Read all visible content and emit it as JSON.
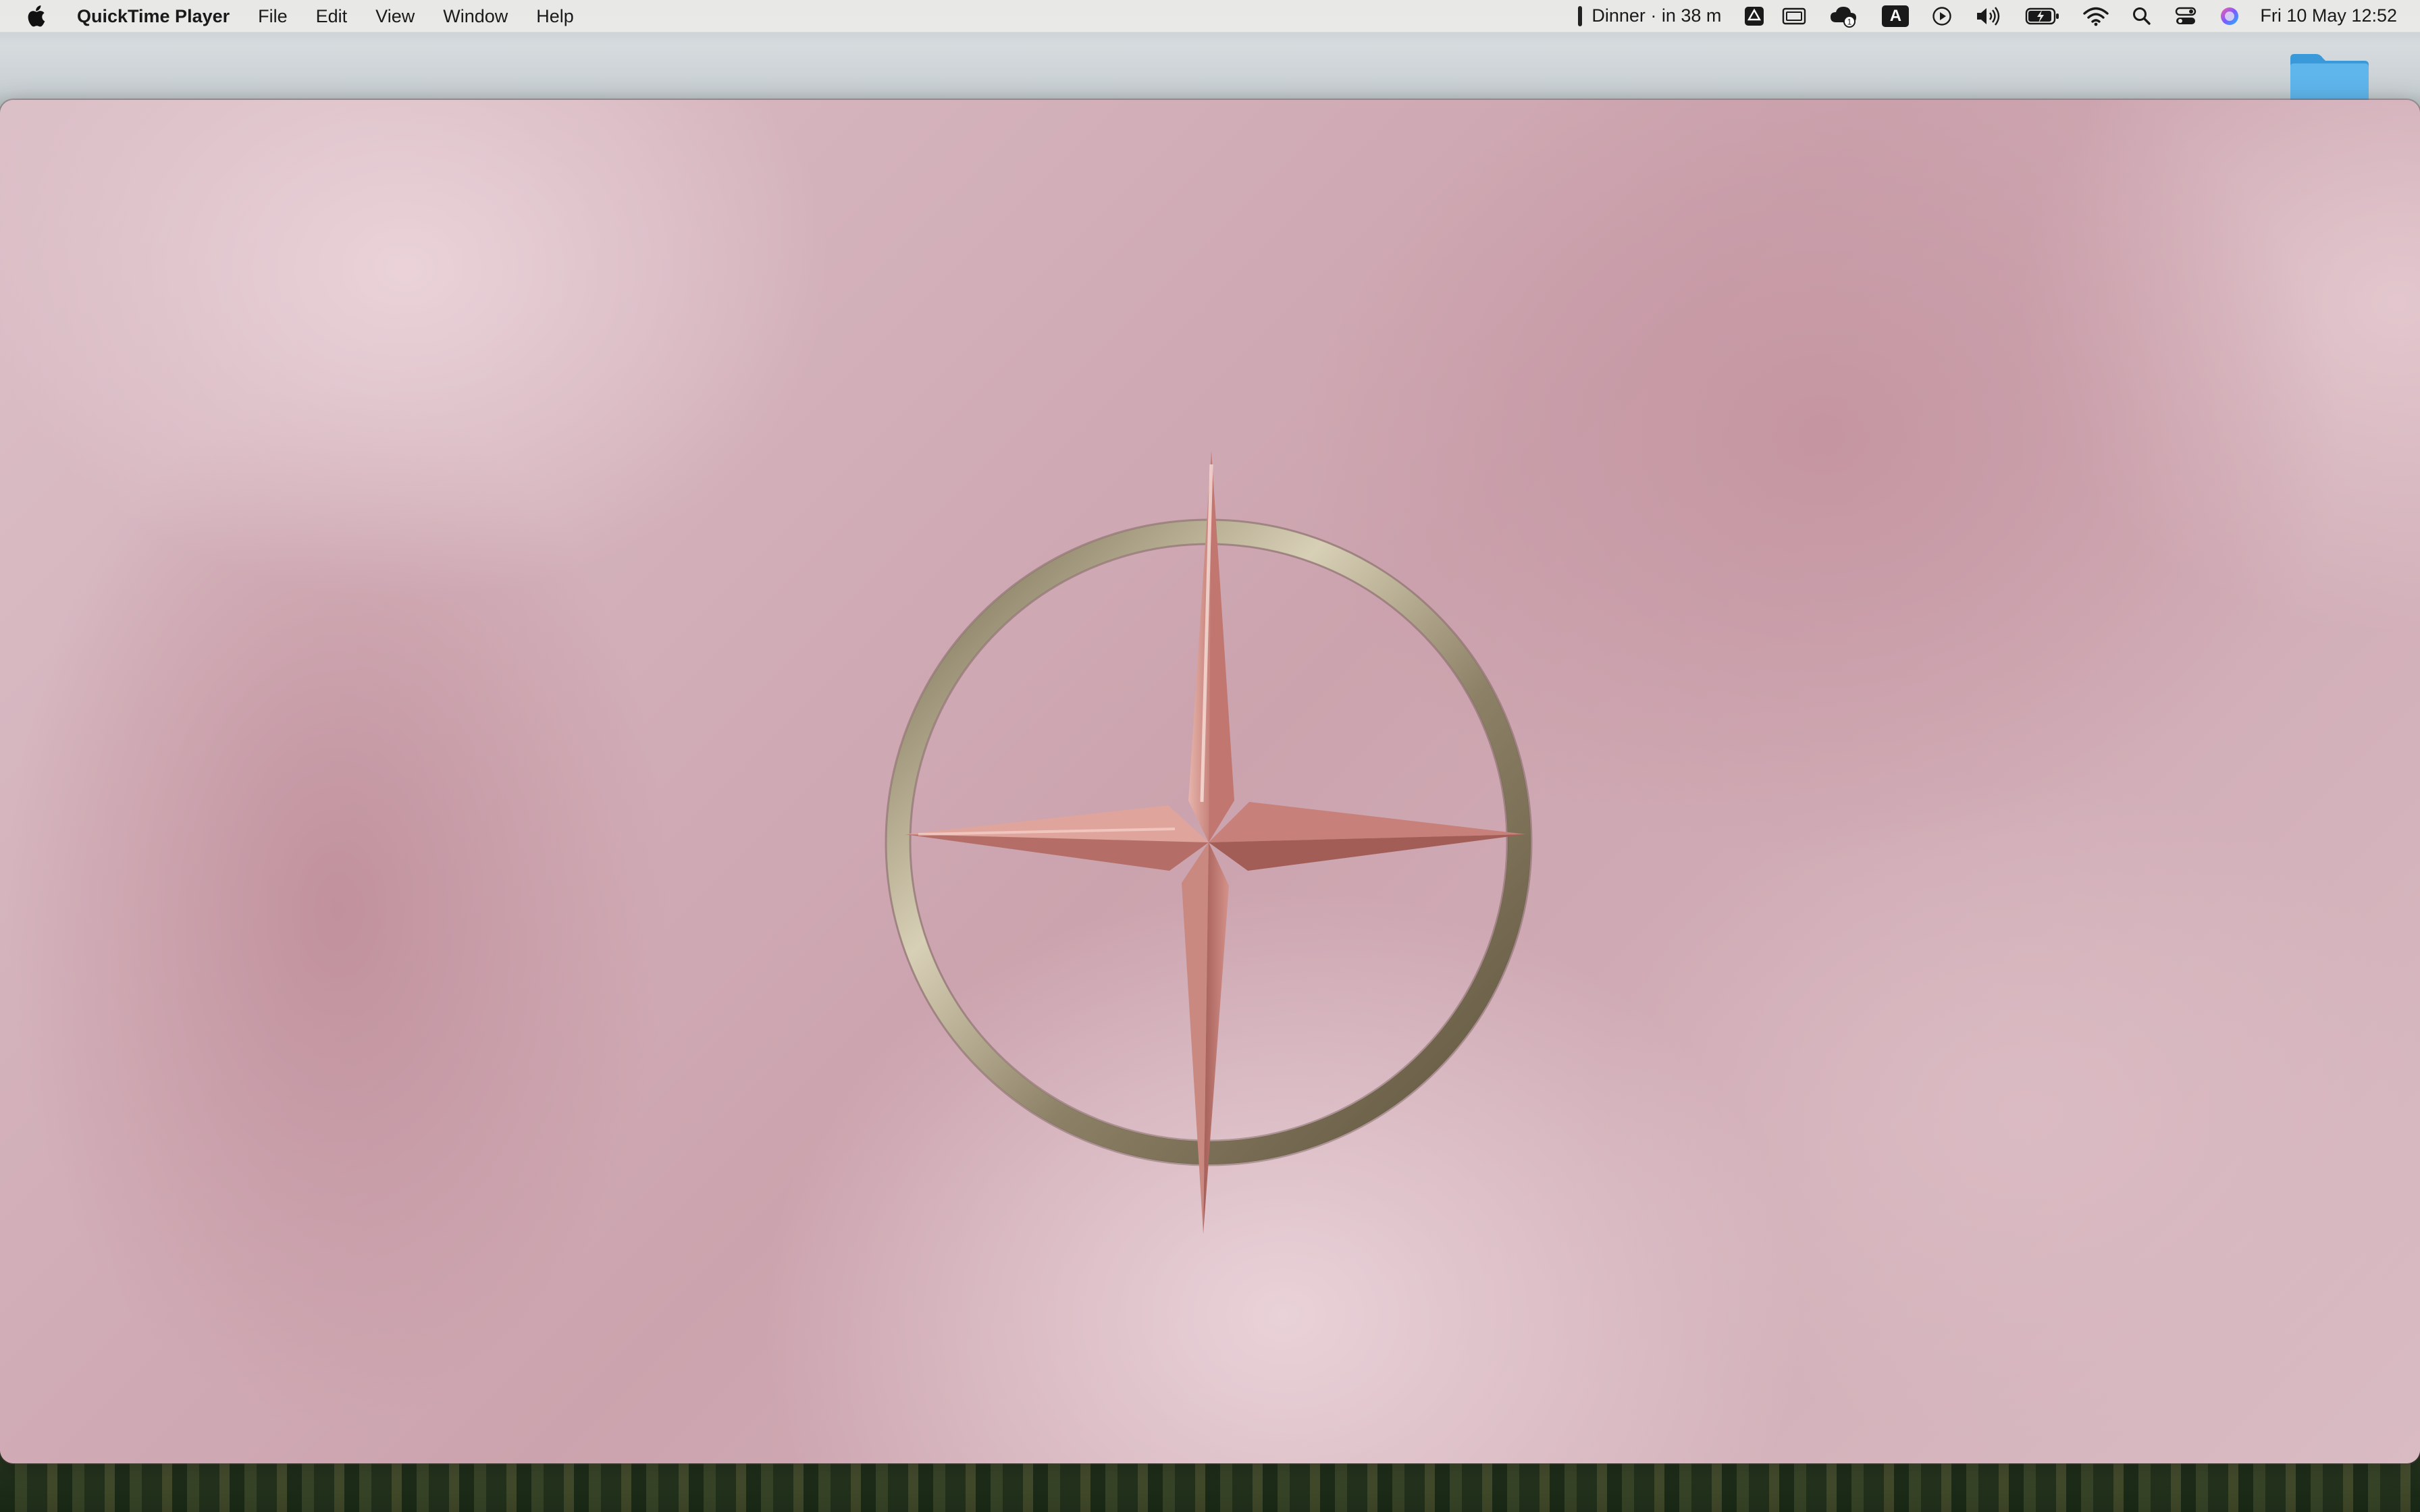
{
  "menubar": {
    "app_name": "QuickTime Player",
    "menus": [
      "File",
      "Edit",
      "View",
      "Window",
      "Help"
    ],
    "status": {
      "calendar_event": "Dinner · in 38 m",
      "drive_icon": "google-drive-icon",
      "display_icon": "display-mirroring-icon",
      "cloud_badge": "1",
      "input_source": "A",
      "clock": "Fri 10 May  12:52"
    }
  },
  "window": {
    "app": "QuickTime Player",
    "content": "video-frame-compass-star"
  },
  "colors": {
    "menubar_bg": "#ecece8",
    "video_pink": "#d7b5be",
    "star_copper": "#c77c74",
    "ring_gold": "#a09578"
  }
}
